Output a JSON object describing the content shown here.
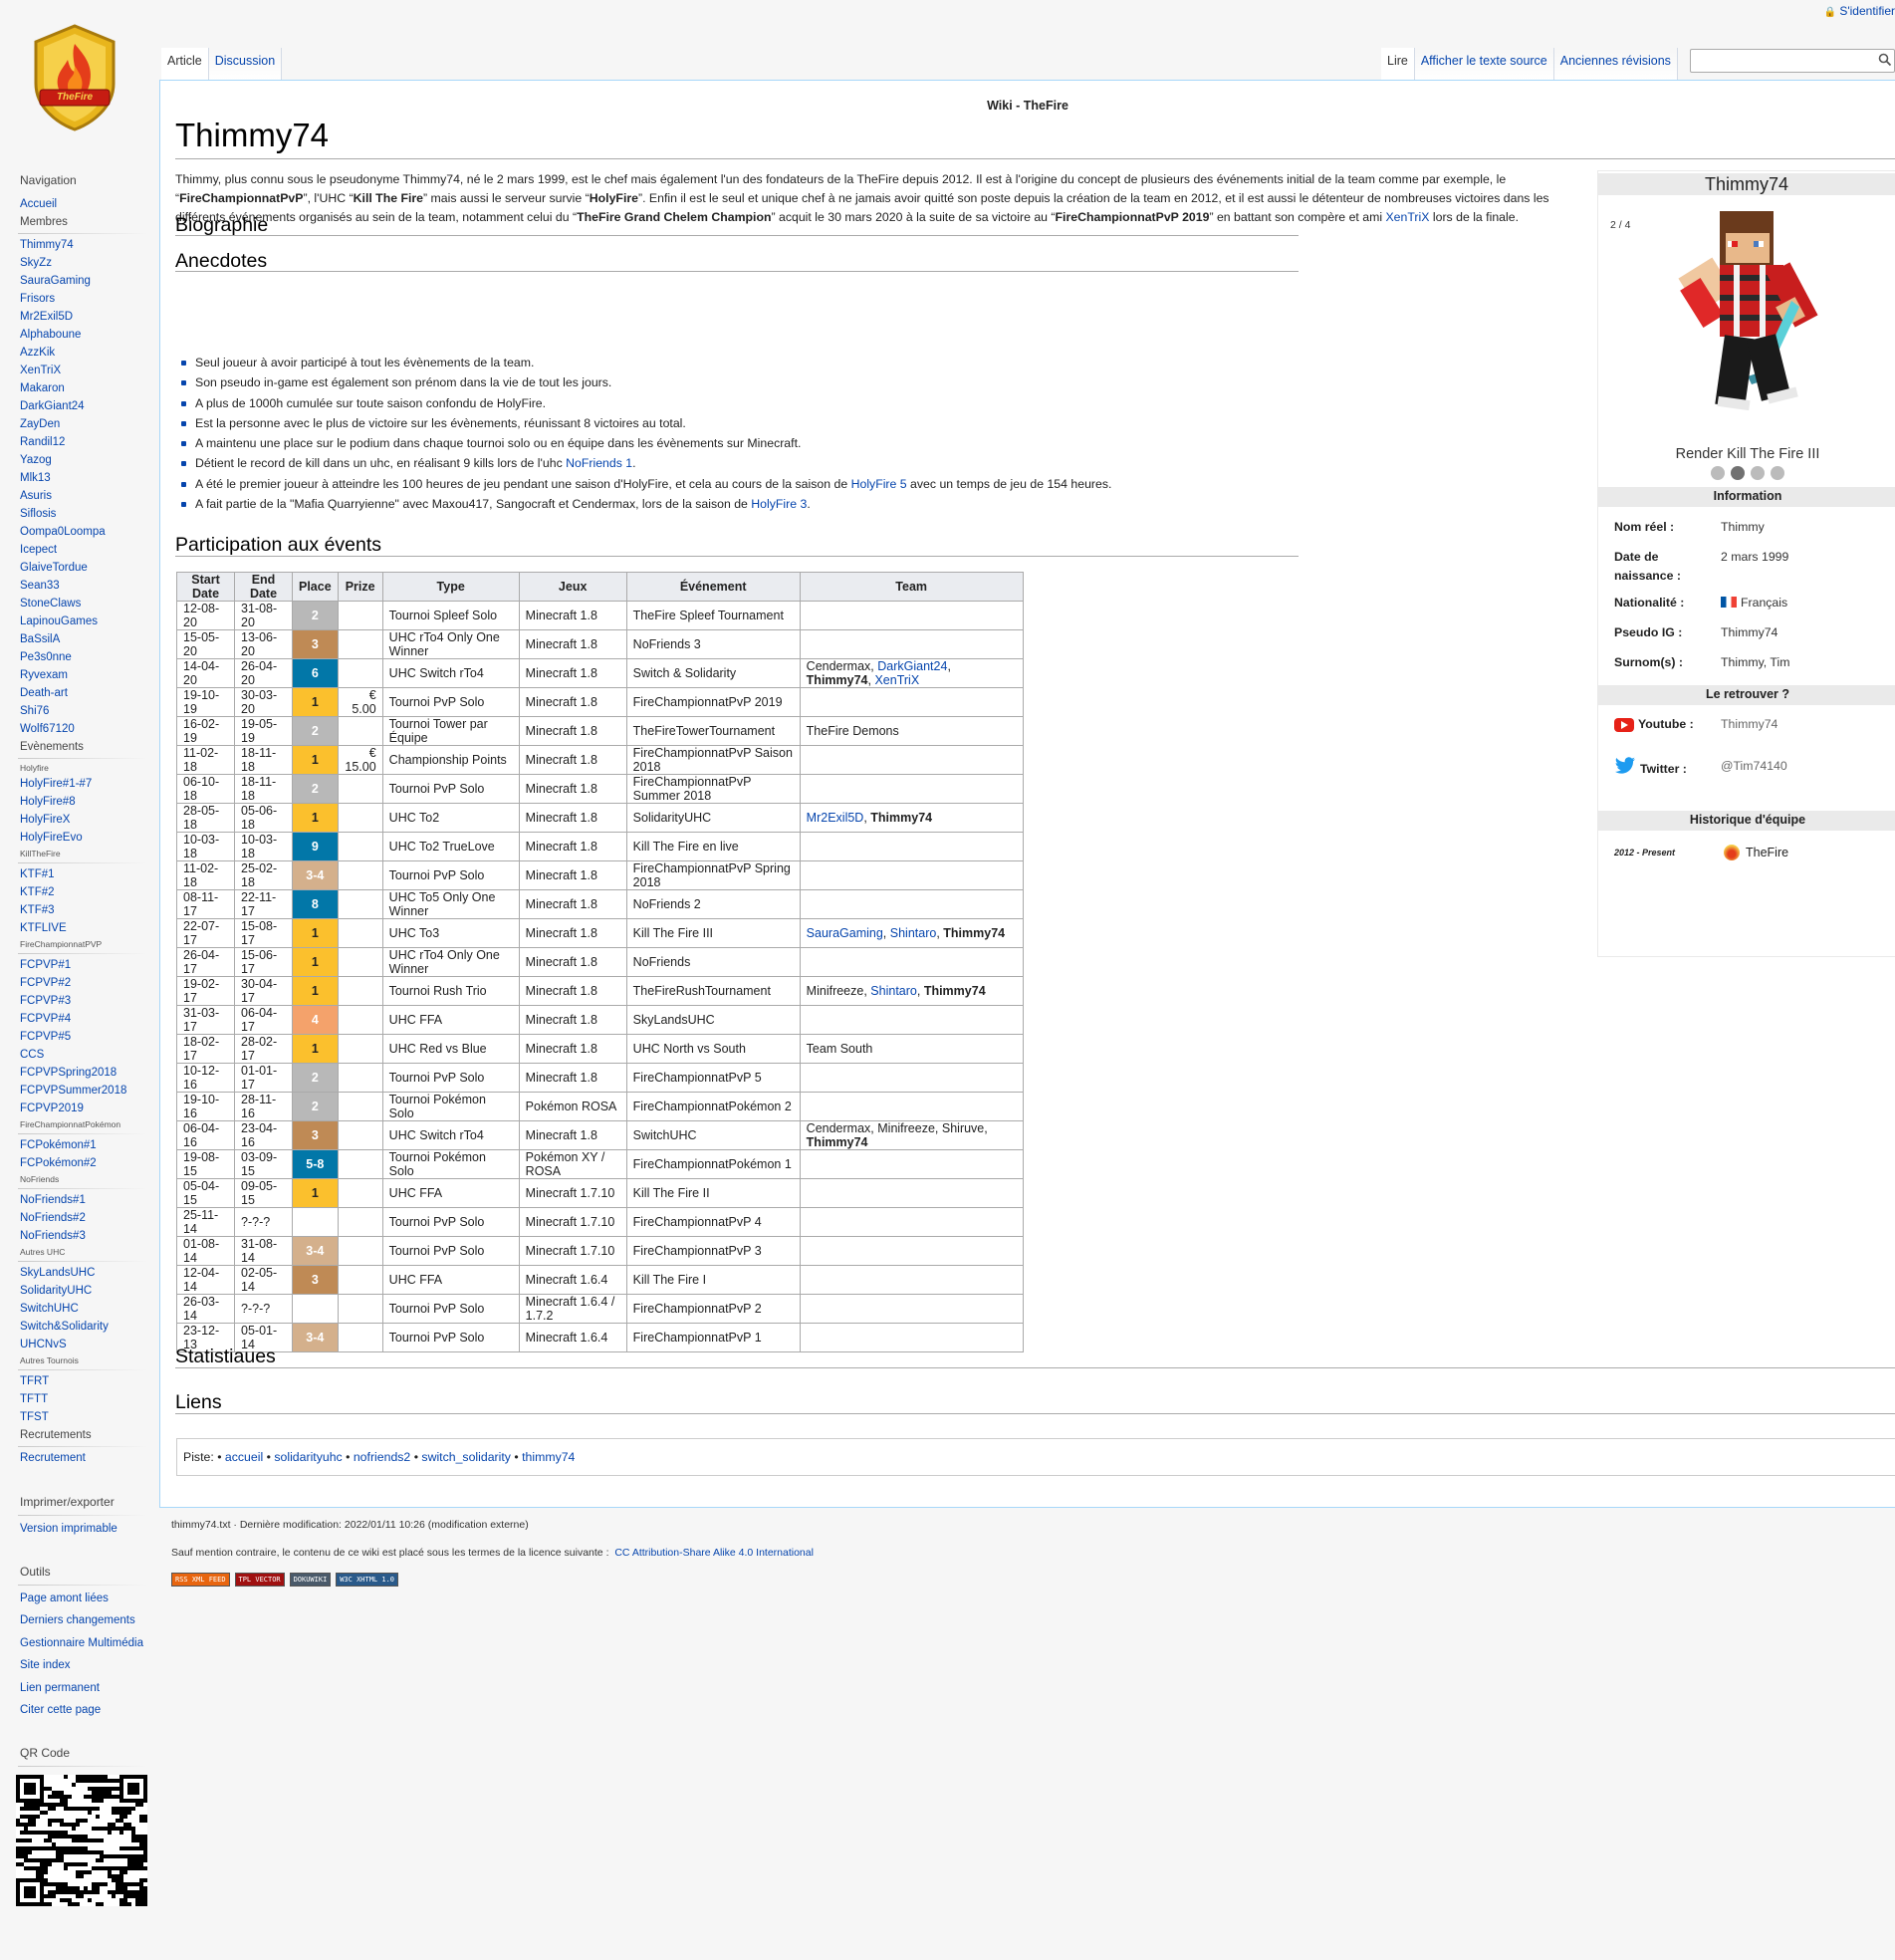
{
  "personal": {
    "login": "S'identifier"
  },
  "logo_text": "TheFire",
  "tabs": {
    "left": [
      "Article",
      "Discussion"
    ],
    "right": [
      "Lire",
      "Afficher le texte source",
      "Anciennes révisions"
    ]
  },
  "search": {
    "placeholder": ""
  },
  "site_title": "Wiki - TheFire",
  "page_title": "Thimmy74",
  "intro": {
    "t1": "Thimmy, plus connu sous le pseudonyme Thimmy74, né le 2 mars 1999, est le chef mais également l'un des fondateurs de la TheFire depuis 2012. Il est à l'origine du concept de plusieurs des événements initial de la team comme par exemple, le “",
    "b1": "FireChampionnatPvP",
    "t2": "”, l'UHC “",
    "b2": "Kill The Fire",
    "t3": "” mais aussi le serveur survie “",
    "b3": "HolyFire",
    "t4": "”. Enfin il est le seul et unique chef à ne jamais avoir quitté son poste depuis la création de la team en 2012, et il est aussi le détenteur de nombreuses victoires dans les différents événements organisés au sein de la team, notamment celui du “",
    "b4": "TheFire Grand Chelem Champion",
    "t5": "” acquit le 30 mars 2020 à la suite de sa victoire au “",
    "b5": "FireChampionnatPvP 2019",
    "t6": "” en battant son compère et ami ",
    "link": "XenTriX",
    "t7": " lors de la finale."
  },
  "headings": {
    "bio": "Biographie",
    "anecdotes": "Anecdotes",
    "events": "Participation aux évents",
    "stats": "Statistiaues",
    "links": "Liens"
  },
  "anecdotes": [
    {
      "text": "Seul joueur à avoir participé à tout les évènements de la team."
    },
    {
      "text": "Son pseudo in-game est également son prénom dans la vie de tout les jours."
    },
    {
      "text": "A plus de 1000h cumulée sur toute saison confondu de HolyFire."
    },
    {
      "text": "Est la personne avec le plus de victoire sur les évènements, réunissant 8 victoires au total."
    },
    {
      "text": "A maintenu une place sur le podium dans chaque tournoi solo ou en équipe dans les évènements sur Minecraft."
    },
    {
      "text": "Détient le record de kill dans un uhc, en réalisant 9 kills lors de l'uhc ",
      "link": "NoFriends 1",
      "after": "."
    },
    {
      "text": "A été le premier joueur à atteindre les 100 heures de jeu pendant une saison d'HolyFire, et cela au cours de la saison de ",
      "link": "HolyFire 5",
      "after": " avec un temps de jeu de 154 heures."
    },
    {
      "text": "A fait partie de la \"Mafia Quarryienne\" avec Maxou417, Sangocraft et Cendermax, lors de la saison de ",
      "link": "HolyFire 3",
      "after": "."
    }
  ],
  "table": {
    "headers": [
      "Start Date",
      "End Date",
      "Place",
      "Prize",
      "Type",
      "Jeux",
      "Événement",
      "Team"
    ],
    "rows": [
      {
        "start": "12-08-20",
        "end": "31-08-20",
        "place": "2",
        "cls": "p2",
        "prize": "",
        "type": "Tournoi Spleef Solo",
        "game": "Minecraft 1.8",
        "event": "TheFire Spleef Tournament",
        "team": []
      },
      {
        "start": "15-05-20",
        "end": "13-06-20",
        "place": "3",
        "cls": "p3",
        "prize": "",
        "type": "UHC rTo4 Only One Winner",
        "game": "Minecraft 1.8",
        "event": "NoFriends 3",
        "team": []
      },
      {
        "start": "14-04-20",
        "end": "26-04-20",
        "place": "6",
        "cls": "pblue",
        "prize": "",
        "type": "UHC Switch rTo4",
        "game": "Minecraft 1.8",
        "event": "Switch & Solidarity",
        "team": [
          {
            "t": "Cendermax"
          },
          {
            "t": "DarkGiant24",
            "l": 1
          },
          {
            "t": "Thimmy74",
            "b": 1
          },
          {
            "t": "XenTriX",
            "l": 1
          }
        ]
      },
      {
        "start": "19-10-19",
        "end": "30-03-20",
        "place": "1",
        "cls": "p1",
        "prize": "€ 5.00",
        "type": "Tournoi PvP Solo",
        "game": "Minecraft 1.8",
        "event": "FireChampionnatPvP 2019",
        "team": []
      },
      {
        "start": "16-02-19",
        "end": "19-05-19",
        "place": "2",
        "cls": "p2",
        "prize": "",
        "type": "Tournoi Tower par Équipe",
        "game": "Minecraft 1.8",
        "event": "TheFireTowerTournament",
        "team": [
          {
            "t": "TheFire Demons"
          }
        ]
      },
      {
        "start": "11-02-18",
        "end": "18-11-18",
        "place": "1",
        "cls": "p1",
        "prize": "€ 15.00",
        "type": "Championship Points",
        "game": "Minecraft 1.8",
        "event": "FireChampionnatPvP Saison 2018",
        "team": []
      },
      {
        "start": "06-10-18",
        "end": "18-11-18",
        "place": "2",
        "cls": "p2",
        "prize": "",
        "type": "Tournoi PvP Solo",
        "game": "Minecraft 1.8",
        "event": "FireChampionnatPvP Summer 2018",
        "team": []
      },
      {
        "start": "28-05-18",
        "end": "05-06-18",
        "place": "1",
        "cls": "p1",
        "prize": "",
        "type": "UHC To2",
        "game": "Minecraft 1.8",
        "event": "SolidarityUHC",
        "team": [
          {
            "t": "Mr2Exil5D",
            "l": 1
          },
          {
            "t": "Thimmy74",
            "b": 1
          }
        ]
      },
      {
        "start": "10-03-18",
        "end": "10-03-18",
        "place": "9",
        "cls": "pblue",
        "prize": "",
        "type": "UHC To2 TrueLove",
        "game": "Minecraft 1.8",
        "event": "Kill The Fire en live",
        "team": []
      },
      {
        "start": "11-02-18",
        "end": "25-02-18",
        "place": "3-4",
        "cls": "p34",
        "prize": "",
        "type": "Tournoi PvP Solo",
        "game": "Minecraft 1.8",
        "event": "FireChampionnatPvP Spring 2018",
        "team": []
      },
      {
        "start": "08-11-17",
        "end": "22-11-17",
        "place": "8",
        "cls": "pblue",
        "prize": "",
        "type": "UHC To5 Only One Winner",
        "game": "Minecraft 1.8",
        "event": "NoFriends 2",
        "team": []
      },
      {
        "start": "22-07-17",
        "end": "15-08-17",
        "place": "1",
        "cls": "p1",
        "prize": "",
        "type": "UHC To3",
        "game": "Minecraft 1.8",
        "event": "Kill The Fire III",
        "team": [
          {
            "t": "SauraGaming",
            "l": 1
          },
          {
            "t": "Shintaro",
            "l": 1
          },
          {
            "t": "Thimmy74",
            "b": 1
          }
        ]
      },
      {
        "start": "26-04-17",
        "end": "15-06-17",
        "place": "1",
        "cls": "p1",
        "prize": "",
        "type": "UHC rTo4 Only One Winner",
        "game": "Minecraft 1.8",
        "event": "NoFriends",
        "team": []
      },
      {
        "start": "19-02-17",
        "end": "30-04-17",
        "place": "1",
        "cls": "p1",
        "prize": "",
        "type": "Tournoi Rush Trio",
        "game": "Minecraft 1.8",
        "event": "TheFireRushTournament",
        "team": [
          {
            "t": "Minifreeze"
          },
          {
            "t": "Shintaro",
            "l": 1
          },
          {
            "t": "Thimmy74",
            "b": 1
          }
        ]
      },
      {
        "start": "31-03-17",
        "end": "06-04-17",
        "place": "4",
        "cls": "p4",
        "prize": "",
        "type": "UHC FFA",
        "game": "Minecraft 1.8",
        "event": "SkyLandsUHC",
        "team": []
      },
      {
        "start": "18-02-17",
        "end": "28-02-17",
        "place": "1",
        "cls": "p1",
        "prize": "",
        "type": "UHC Red vs Blue",
        "game": "Minecraft 1.8",
        "event": "UHC North vs South",
        "team": [
          {
            "t": "Team South"
          }
        ]
      },
      {
        "start": "10-12-16",
        "end": "01-01-17",
        "place": "2",
        "cls": "p2",
        "prize": "",
        "type": "Tournoi PvP Solo",
        "game": "Minecraft 1.8",
        "event": "FireChampionnatPvP 5",
        "team": []
      },
      {
        "start": "19-10-16",
        "end": "28-11-16",
        "place": "2",
        "cls": "p2",
        "prize": "",
        "type": "Tournoi Pokémon Solo",
        "game": "Pokémon ROSA",
        "event": "FireChampionnatPokémon 2",
        "team": []
      },
      {
        "start": "06-04-16",
        "end": "23-04-16",
        "place": "3",
        "cls": "p3",
        "prize": "",
        "type": "UHC Switch rTo4",
        "game": "Minecraft 1.8",
        "event": "SwitchUHC",
        "team": [
          {
            "t": "Cendermax"
          },
          {
            "t": "Minifreeze"
          },
          {
            "t": "Shiruve"
          },
          {
            "t": "Thimmy74",
            "b": 1
          }
        ]
      },
      {
        "start": "19-08-15",
        "end": "03-09-15",
        "place": "5-8",
        "cls": "pblue",
        "prize": "",
        "type": "Tournoi Pokémon Solo",
        "game": "Pokémon XY / ROSA",
        "event": "FireChampionnatPokémon 1",
        "team": []
      },
      {
        "start": "05-04-15",
        "end": "09-05-15",
        "place": "1",
        "cls": "p1",
        "prize": "",
        "type": "UHC FFA",
        "game": "Minecraft 1.7.10",
        "event": "Kill The Fire II",
        "team": []
      },
      {
        "start": "25-11-14",
        "end": "?-?-?",
        "place": "",
        "cls": "",
        "prize": "",
        "type": "Tournoi PvP Solo",
        "game": "Minecraft 1.7.10",
        "event": "FireChampionnatPvP 4",
        "team": []
      },
      {
        "start": "01-08-14",
        "end": "31-08-14",
        "place": "3-4",
        "cls": "p34",
        "prize": "",
        "type": "Tournoi PvP Solo",
        "game": "Minecraft 1.7.10",
        "event": "FireChampionnatPvP 3",
        "team": []
      },
      {
        "start": "12-04-14",
        "end": "02-05-14",
        "place": "3",
        "cls": "p3",
        "prize": "",
        "type": "UHC FFA",
        "game": "Minecraft 1.6.4",
        "event": "Kill The Fire I",
        "team": []
      },
      {
        "start": "26-03-14",
        "end": "?-?-?",
        "place": "",
        "cls": "",
        "prize": "",
        "type": "Tournoi PvP Solo",
        "game": "Minecraft 1.6.4 / 1.7.2",
        "event": "FireChampionnatPvP 2",
        "team": []
      },
      {
        "start": "23-12-13",
        "end": "05-01-14",
        "place": "3-4",
        "cls": "p34",
        "prize": "",
        "type": "Tournoi PvP Solo",
        "game": "Minecraft 1.6.4",
        "event": "FireChampionnatPvP 1",
        "team": []
      }
    ]
  },
  "tags": {
    "label": "Piste:",
    "items": [
      "accueil",
      "solidarityuhc",
      "nofriends2",
      "switch_solidarity",
      "thimmy74"
    ]
  },
  "infobox": {
    "title": "Thimmy74",
    "counter": "2 / 4",
    "caption": "Render Kill The Fire III",
    "info_header": "Information",
    "rows": [
      {
        "label": "Nom réel :",
        "value": "Thimmy"
      },
      {
        "label": "Date de naissance :",
        "value": "2 mars 1999"
      },
      {
        "label": "Nationalité :",
        "value": "Français"
      },
      {
        "label": "Pseudo IG :",
        "value": "Thimmy74"
      },
      {
        "label": "Surnom(s) :",
        "value": "Thimmy, Tim"
      }
    ],
    "find_header": "Le retrouver ?",
    "youtube_label": "Youtube :",
    "youtube_value": "Thimmy74",
    "twitter_label": "Twitter :",
    "twitter_value": "@Tim74140",
    "history_header": "Historique d'équipe",
    "history_years": "2012 - Present",
    "history_team": "TheFire"
  },
  "sidebar": {
    "navigation": "Navigation",
    "accueil": "Accueil",
    "membres": "Membres",
    "members": [
      "Thimmy74",
      "SkyZz",
      "SauraGaming",
      "Frisors",
      "Mr2Exil5D",
      "Alphaboune",
      "AzzKik",
      "XenTriX",
      "Makaron",
      "DarkGiant24",
      "ZayDen",
      "Randil12",
      "Yazog",
      "Mlk13",
      "Asuris",
      "Siflosis",
      "Oompa0Loompa",
      "Icepect",
      "GlaiveTordue",
      "Sean33",
      "StoneClaws",
      "LapinouGames",
      "BaSsilA",
      "Pe3s0nne",
      "Ryvexam",
      "Death-art",
      "Shi76",
      "Wolf67120"
    ],
    "evenements": "Evènements",
    "holyfire_label": "Holyfire",
    "holyfire": [
      "HolyFire#1-#7",
      "HolyFire#8",
      "HolyFireX",
      "HolyFireEvo"
    ],
    "ktf_label": "KillTheFire",
    "ktf": [
      "KTF#1",
      "KTF#2",
      "KTF#3",
      "KTFLIVE"
    ],
    "fcpvp_label": "FireChampionnatPVP",
    "fcpvp": [
      "FCPVP#1",
      "FCPVP#2",
      "FCPVP#3",
      "FCPVP#4",
      "FCPVP#5",
      "CCS",
      "FCPVPSpring2018",
      "FCPVPSummer2018",
      "FCPVP2019"
    ],
    "fcpoke_label": "FireChampionnatPokémon",
    "fcpoke": [
      "FCPokémon#1",
      "FCPokémon#2"
    ],
    "nofriends_label": "NoFriends",
    "nofriends": [
      "NoFriends#1",
      "NoFriends#2",
      "NoFriends#3"
    ],
    "autres_uhc_label": "Autres UHC",
    "autres_uhc": [
      "SkyLandsUHC",
      "SolidarityUHC",
      "SwitchUHC",
      "Switch&Solidarity",
      "UHCNvS"
    ],
    "autres_tournois_label": "Autres Tournois",
    "autres_tournois": [
      "TFRT",
      "TFTT",
      "TFST"
    ],
    "recrutements": "Recrutements",
    "recrutement": "Recrutement",
    "print_header": "Imprimer/exporter",
    "print_version": "Version imprimable",
    "tools_header": "Outils",
    "tools": [
      "Page amont liées",
      "Derniers changements",
      "Gestionnaire Multimédia",
      "Site index",
      "Lien permanent",
      "Citer cette page"
    ],
    "qr_header": "QR Code"
  },
  "footer": {
    "line1": "thimmy74.txt · Dernière modification: 2022/01/11 10:26 (modification externe)",
    "line2": "Sauf mention contraire, le contenu de ce wiki est placé sous les termes de la licence suivante :",
    "license": "CC Attribution-Share Alike 4.0 International",
    "badges": [
      "RSS XML FEED",
      "TPL VECTOR",
      "DOKUWIKI",
      "W3C XHTML 1.0"
    ]
  },
  "colors": {
    "link": "#0645ad",
    "gold": "#fbc02d",
    "silver": "#b8b8b8",
    "bronze": "#bf8a55",
    "blue": "#0277a8"
  }
}
